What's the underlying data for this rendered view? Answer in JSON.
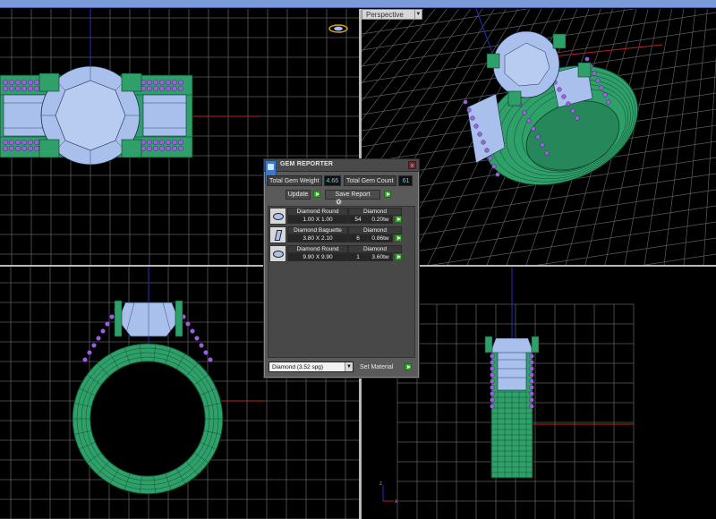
{
  "viewports": {
    "perspective_label": "Perspective"
  },
  "panel": {
    "title": "GEM REPORTER",
    "close_glyph": "x",
    "total_weight_label": "Total Gem Weight",
    "total_weight_value": "4.66",
    "total_count_label": "Total Gem Count",
    "total_count_value": "61",
    "update_label": "Update",
    "save_report_label": "Save Report",
    "expand_glyph": "▾",
    "gems": [
      {
        "shape": "Diamond Round",
        "size": "1.00 X 1.00",
        "material": "Diamond",
        "count": "54",
        "weight": "0.20tw",
        "icon": "round-gem-icon"
      },
      {
        "shape": "Diamond Baguette",
        "size": "3.80 X 2.10",
        "material": "Diamond",
        "count": "6",
        "weight": "0.86tw",
        "icon": "baguette-gem-icon"
      },
      {
        "shape": "Diamond Round",
        "size": "9.90 X 9.90",
        "material": "Diamond",
        "count": "1",
        "weight": "3.60tw",
        "icon": "round-gem-icon"
      }
    ],
    "material_select_value": "Diamond   (3.52 spg)",
    "set_material_label": "Set Material"
  },
  "colors": {
    "grid": "#5c5c5c",
    "metal": "#2fa06a",
    "gem": "#a9c0ec",
    "pave": "#9a62d8",
    "axis_x": "#c0201a",
    "axis_y": "#2030c8",
    "accent_value": "#52d8e0",
    "go_button": "#3da830"
  }
}
